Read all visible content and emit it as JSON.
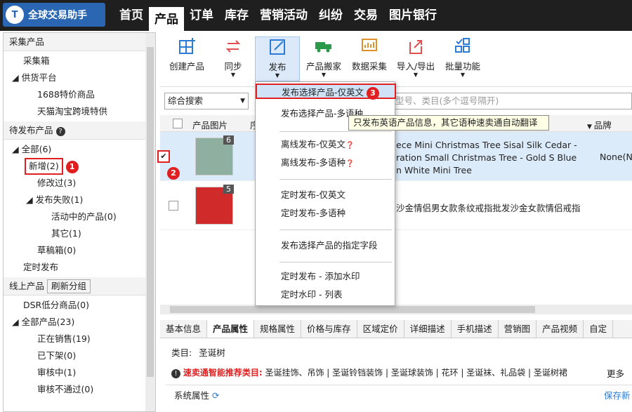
{
  "app": {
    "logo_mark": "T",
    "title": "全球交易助手"
  },
  "nav": [
    "首页",
    "产品",
    "订单",
    "库存",
    "营销活动",
    "纠纷",
    "交易",
    "图片银行"
  ],
  "left": {
    "collect_header": "采集产品",
    "collect_items": [
      "采集箱",
      "供货平台",
      "1688特价商品",
      "天猫淘宝跨境特供"
    ],
    "pending_header": "待发布产品",
    "pending_items": [
      "全部(6)",
      "新增(2)",
      "修改过(3)",
      "发布失败(1)",
      "活动中的产品(0)",
      "其它(1)",
      "草稿箱(0)",
      "定时发布"
    ],
    "online_header": "线上产品",
    "refresh_label": "刷新分组",
    "online_items": [
      "DSR低分商品(0)",
      "全部产品(23)",
      "正在销售(19)",
      "已下架(0)",
      "审核中(1)",
      "审核不通过(0)"
    ]
  },
  "toolbar": [
    "创建产品",
    "同步",
    "发布",
    "产品搬家",
    "数据采集",
    "导入/导出",
    "批量功能"
  ],
  "search": {
    "mode": "综合搜索",
    "placeholder": "型号、类目(多个逗号隔开)"
  },
  "grid": {
    "headers": [
      "产品图片",
      "序",
      "品牌"
    ],
    "rows": [
      {
        "count": "6",
        "title_lines": [
          "ece Mini Christmas Tree Sisal Silk Cedar -",
          "ration Small Christmas Tree - Gold S Blue",
          "n White Mini Tree"
        ],
        "brand": "None(N"
      },
      {
        "count": "5",
        "title_lines": [
          "沙金情侣男女款条纹戒指批发沙金女款情侣戒指"
        ],
        "brand": ""
      }
    ]
  },
  "menu": {
    "items": [
      "发布选择产品-仅英文",
      "发布选择产品-多语种",
      "离线发布-仅英文",
      "离线发布-多语种",
      "定时发布-仅英文",
      "定时发布-多语种",
      "发布选择产品的指定字段",
      "定时发布 - 添加水印",
      "定时水印 - 列表"
    ],
    "tooltip": "只发布英语产品信息，其它语种速卖通自动翻译"
  },
  "badges": [
    "1",
    "2",
    "3"
  ],
  "tabs": [
    "基本信息",
    "产品属性",
    "规格属性",
    "价格与库存",
    "区域定价",
    "详细描述",
    "手机描述",
    "营销图",
    "产品视频",
    "自定"
  ],
  "attr": {
    "category_label": "类目:",
    "category_value": "圣诞树",
    "recommend_label": "速卖通智能推荐类目:",
    "recommend_items": [
      "圣诞挂饰、吊饰",
      "圣诞铃铛装饰",
      "圣诞球装饰",
      "花环",
      "圣诞袜、礼品袋",
      "圣诞树裙"
    ],
    "more": "更多",
    "sys_attr": "系统属性",
    "save_new": "保存新"
  }
}
